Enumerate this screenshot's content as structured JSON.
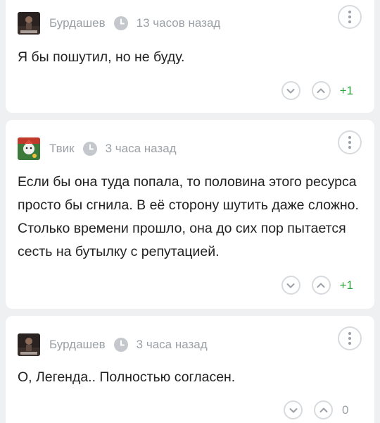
{
  "comments": [
    {
      "author": "Бурдашев",
      "avatar": "burdashev-avatar",
      "time": "13 часов назад",
      "text": "Я бы пошутил, но не буду.",
      "score": "+1"
    },
    {
      "author": "Твик",
      "avatar": "tvik-avatar",
      "time": "3 часа назад",
      "text": "Если бы она туда попала, то половина этого ресурса просто бы сгнила. В её сторону шутить даже сложно. Столько времени прошло, она до сих пор пытается сесть на бутылку с репутацией.",
      "score": "+1"
    },
    {
      "author": "Бурдашев",
      "avatar": "burdashev-avatar",
      "time": "3 часа назад",
      "text": "О, Легенда.. Полностью согласен.",
      "score": "0"
    }
  ],
  "colors": {
    "background": "#eef0f1",
    "card": "#ffffff",
    "muted": "#9aa0a5",
    "positive": "#27a33a",
    "text": "#222222"
  },
  "icons": {
    "time": "clock-icon",
    "menu": "more-vertical-icon",
    "downvote": "chevron-down-icon",
    "upvote": "chevron-up-icon"
  }
}
